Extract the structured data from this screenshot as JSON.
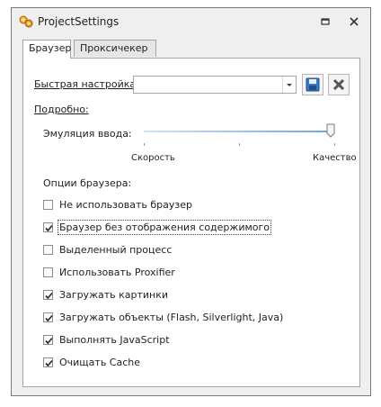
{
  "window": {
    "title": "ProjectSettings",
    "icons": {
      "app": "projectsettings-app-icon",
      "restore": "restore-icon",
      "close": "close-icon"
    }
  },
  "tabs": [
    {
      "label": "Браузер",
      "active": true
    },
    {
      "label": "Проксичекер",
      "active": false
    }
  ],
  "quick_setup": {
    "label": "Быстрая настройка:",
    "value": "",
    "save_icon": "save-disk-icon",
    "delete_icon": "delete-x-icon"
  },
  "detail_label": "Подробно:",
  "emulation": {
    "label": "Эмуляция ввода:",
    "level": 1.0,
    "min_label": "Скорость",
    "max_label": "Качество"
  },
  "options": {
    "label": "Опции браузера:",
    "items": [
      {
        "label": "Не использовать браузер",
        "checked": false
      },
      {
        "label": "Браузер без отображения содержимого",
        "checked": true
      },
      {
        "label": "Выделенный процесс",
        "checked": false
      },
      {
        "label": "Использовать Proxifier",
        "checked": false
      },
      {
        "label": "Загружать картинки",
        "checked": true
      },
      {
        "label": "Загружать объекты (Flash, Silverlight, Java)",
        "checked": true
      },
      {
        "label": "Выполнять JavaScript",
        "checked": true
      },
      {
        "label": "Очищать Cache",
        "checked": true
      }
    ]
  }
}
